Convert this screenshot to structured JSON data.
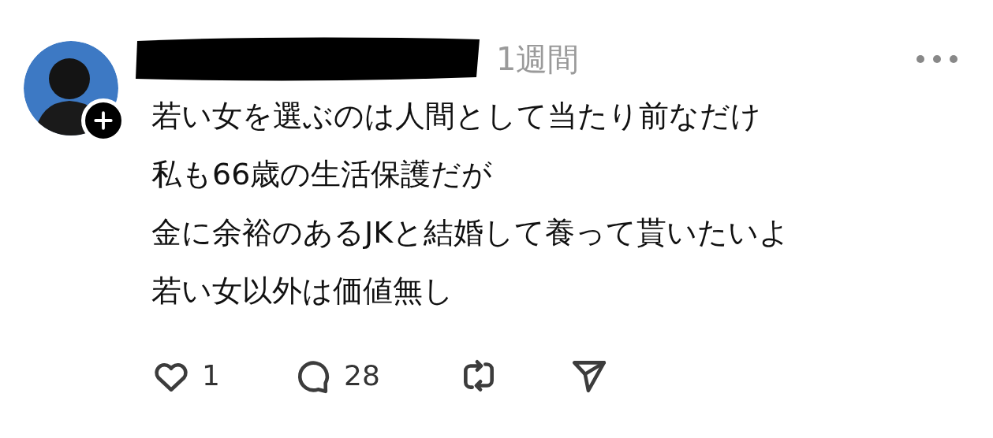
{
  "post": {
    "time": "1週間",
    "lines": [
      "若い女を選ぶのは人間として当たり前なだけ",
      "私も66歳の生活保護だが",
      "金に余裕のあるJKと結婚して養って貰いたいよ",
      "若い女以外は価値無し"
    ],
    "actions": [
      {
        "kind": "like",
        "count": "1"
      },
      {
        "kind": "comment",
        "count": "28"
      },
      {
        "kind": "repost"
      },
      {
        "kind": "share"
      }
    ]
  }
}
